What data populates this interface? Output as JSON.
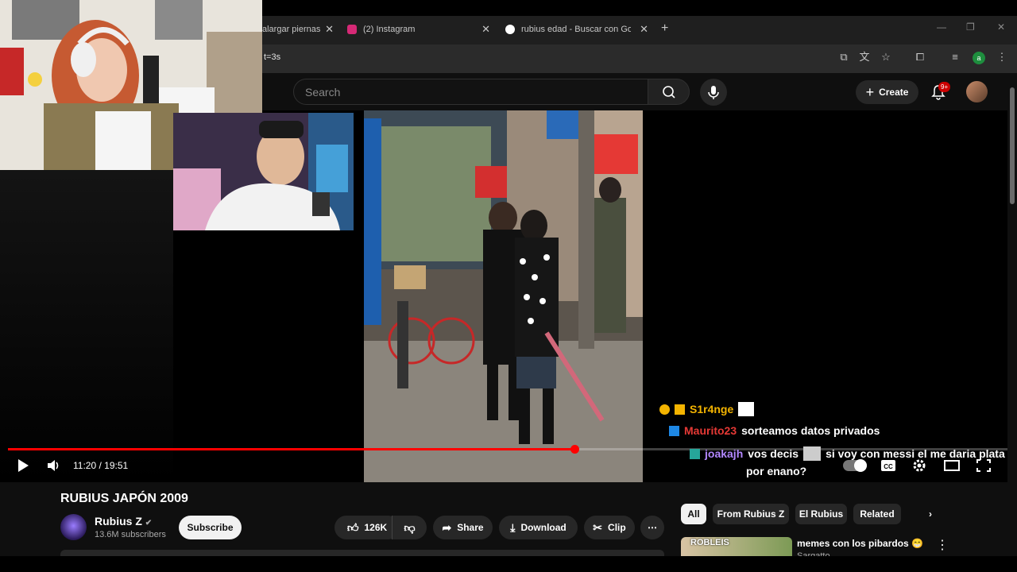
{
  "browser": {
    "tabs": [
      {
        "title": "alargar piernas",
        "favicon_color": "#1f1f1f"
      },
      {
        "title": "(2) Instagram",
        "favicon_color": "#d62976"
      },
      {
        "title": "rubius edad - Buscar con Google",
        "favicon_color": "#ffffff"
      }
    ],
    "url_fragment": "t=3s",
    "profile_letter": "a"
  },
  "youtube": {
    "search_placeholder": "Search",
    "create_label": "Create",
    "notif_badge": "9+"
  },
  "player": {
    "current_time": "11:20",
    "duration": "19:51",
    "time_label": "11:20 / 19:51",
    "progress_fraction": 0.567
  },
  "chat": [
    {
      "user": "S1r4nge",
      "user_color": "#f4b400",
      "message": ""
    },
    {
      "user": "Maurito23",
      "user_color": "#e53935",
      "message": "sorteamos datos privados"
    },
    {
      "user": "joakajh",
      "user_color": "#b388ff",
      "message": "vos decis",
      "message2": "si voy con messi el me daria plata",
      "message3": "por enano?"
    }
  ],
  "video": {
    "title": "RUBIUS JAPÓN 2009",
    "channel": "Rubius Z",
    "subscribers": "13.6M subscribers",
    "subscribe_label": "Subscribe",
    "likes": "126K",
    "share_label": "Share",
    "download_label": "Download",
    "clip_label": "Clip"
  },
  "chips": [
    "All",
    "From Rubius Z",
    "El Rubius",
    "Related"
  ],
  "recommendation": {
    "title": "memes con los pibardos 😁",
    "channel": "Sargatto",
    "thumb_text": "ROBLEIS"
  }
}
